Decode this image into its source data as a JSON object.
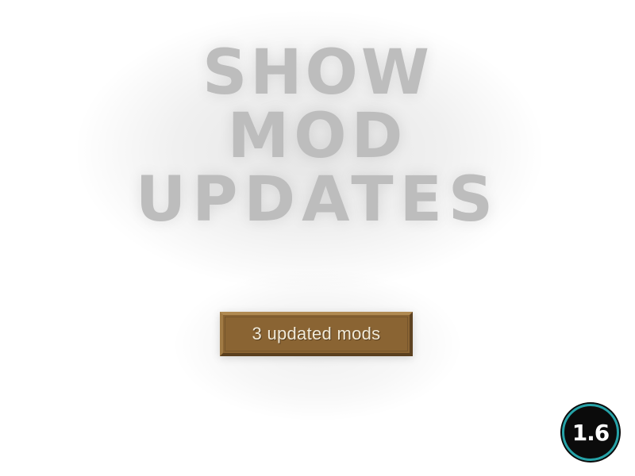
{
  "title": {
    "line1": "SHOW",
    "line2": "MOD",
    "line3": "UPDATES"
  },
  "button": {
    "label": "3 updated mods"
  },
  "badge": {
    "version": "1.6"
  },
  "colors": {
    "title": "#bdbdbd",
    "button_fill": "#8a6433",
    "button_text": "#f1ead8",
    "badge_fill": "#0b0b0b",
    "badge_ring": "#26a3a8"
  }
}
